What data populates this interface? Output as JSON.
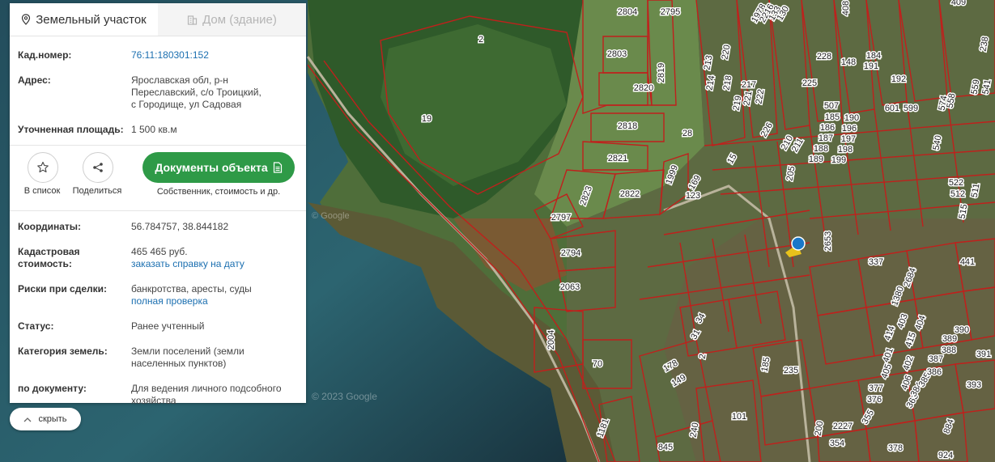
{
  "tabs": {
    "land": {
      "label": "Земельный участок",
      "icon": "location-pin-icon"
    },
    "house": {
      "label": "Дом (здание)",
      "icon": "building-icon"
    }
  },
  "info": {
    "cad_label": "Кад.номер:",
    "cad_value": "76:11:180301:152",
    "addr_label": "Адрес:",
    "addr_value": "Ярославская обл, р-н Переславский, с/о Троицкий, с Городище, ул Садовая",
    "area_label": "Уточненная площадь:",
    "area_value": "1 500 кв.м"
  },
  "actions": {
    "list_label": "В список",
    "list_icon": "star-icon",
    "share_label": "Поделиться",
    "share_icon": "share-icon",
    "docs_label": "Документы объекта",
    "docs_icon": "document-icon",
    "docs_sub": "Собственник, стоимость и др."
  },
  "details": {
    "coords_label": "Координаты:",
    "coords_value": "56.784757, 38.844182",
    "cost_label": "Кадастровая стоимость:",
    "cost_value": "465 465 руб.",
    "cost_link": "заказать справку на дату",
    "risk_label": "Риски при сделки:",
    "risk_value": "банкротства, аресты, суды",
    "risk_link": "полная проверка",
    "status_label": "Статус:",
    "status_value": "Ранее учтенный",
    "cat_label": "Категория земель:",
    "cat_value": "Земли поселений (земли населенных пунктов)",
    "doc_label": "по документу:",
    "doc_value": "Для ведения личного подсобного хозяйства"
  },
  "hide_button": {
    "label": "скрыть",
    "icon": "chevron-up-icon"
  },
  "map": {
    "watermarks": [
      "© 2023 Google",
      "© Google"
    ],
    "parcel_labels": [
      "2804",
      "2795",
      "2803",
      "2",
      "2820",
      "2819",
      "19",
      "2818",
      "28",
      "2821",
      "1999",
      "2823",
      "2822",
      "169",
      "123",
      "15",
      "2797",
      "2794",
      "2063",
      "2004",
      "70",
      "178",
      "149",
      "31",
      "34",
      "2",
      "185",
      "235",
      "101",
      "845",
      "240",
      "1181",
      "2653",
      "337",
      "441",
      "226",
      "205",
      "210",
      "211",
      "213",
      "214",
      "217",
      "221",
      "222",
      "218",
      "219",
      "220",
      "225",
      "228",
      "148",
      "184",
      "191",
      "192",
      "601",
      "599",
      "574",
      "558",
      "559",
      "541",
      "540",
      "522",
      "512",
      "511",
      "515",
      "507",
      "185",
      "186",
      "187",
      "188",
      "189",
      "190",
      "196",
      "197",
      "198",
      "199",
      "200",
      "2227",
      "354",
      "355",
      "376",
      "377",
      "378",
      "363",
      "384",
      "385",
      "386",
      "387",
      "388",
      "389",
      "390",
      "391",
      "393",
      "924",
      "884",
      "1380",
      "2684",
      "414",
      "415",
      "401",
      "402",
      "403",
      "404",
      "405",
      "406",
      "408",
      "409",
      "238",
      "1978",
      "2216",
      "133",
      "130",
      "131",
      "132"
    ]
  },
  "colors": {
    "accent_green": "#2e9a47",
    "link_blue": "#1b6fb0",
    "parcel_line": "#c0201c",
    "marker_blue": "#1a77c9",
    "marker_yellow": "#e7c21b"
  }
}
